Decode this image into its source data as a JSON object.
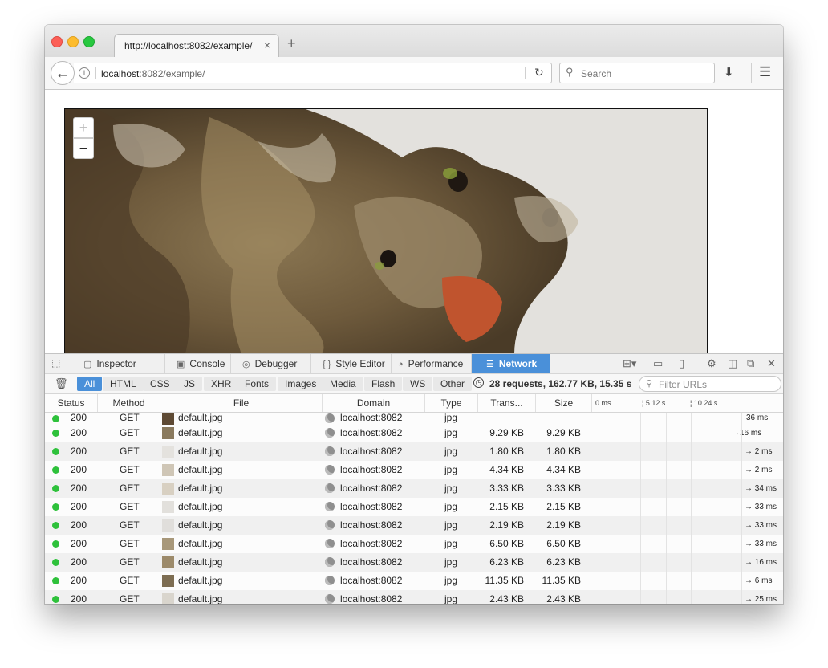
{
  "tab": {
    "title": "http://localhost:8082/example/",
    "close": "×",
    "new_tab": "+"
  },
  "nav": {
    "url_host": "localhost",
    "url_rest": ":8082/example/",
    "search_placeholder": "Search"
  },
  "viewer": {
    "zoom_in": "+",
    "zoom_out": "−"
  },
  "devtools": {
    "tabs": [
      {
        "label": "Inspector",
        "icon": "box-icon"
      },
      {
        "label": "Console",
        "icon": "console-icon"
      },
      {
        "label": "Debugger",
        "icon": "pause-icon"
      },
      {
        "label": "Style Editor",
        "icon": "braces-icon"
      },
      {
        "label": "Performance",
        "icon": "gauge-icon"
      },
      {
        "label": "Network",
        "icon": "network-icon",
        "active": true
      }
    ],
    "filters": [
      "All",
      "HTML",
      "CSS",
      "JS",
      "XHR",
      "Fonts",
      "Images",
      "Media",
      "Flash",
      "WS",
      "Other"
    ],
    "summary": "28 requests, 162.77 KB, 15.35 s",
    "filter_placeholder": "Filter URLs",
    "headers": [
      "Status",
      "Method",
      "File",
      "Domain",
      "Type",
      "Trans...",
      "Size"
    ],
    "timeline_ticks": [
      "0 ms",
      "5.12 s",
      "10.24 s"
    ],
    "partial_row": {
      "status": "200",
      "method": "GET",
      "file": "default.jpg",
      "domain": "localhost:8082",
      "type": "jpg",
      "timing": "36 ms"
    },
    "rows": [
      {
        "status": "200",
        "method": "GET",
        "file": "default.jpg",
        "domain": "localhost:8082",
        "type": "jpg",
        "transferred": "9.29 KB",
        "size": "9.29 KB",
        "timing": "→16 ms",
        "thumb": "#8a7a5e"
      },
      {
        "status": "200",
        "method": "GET",
        "file": "default.jpg",
        "domain": "localhost:8082",
        "type": "jpg",
        "transferred": "1.80 KB",
        "size": "1.80 KB",
        "timing": "→ 2 ms",
        "thumb": "#e4e2de"
      },
      {
        "status": "200",
        "method": "GET",
        "file": "default.jpg",
        "domain": "localhost:8082",
        "type": "jpg",
        "transferred": "4.34 KB",
        "size": "4.34 KB",
        "timing": "→ 2 ms",
        "thumb": "#cfc6b6"
      },
      {
        "status": "200",
        "method": "GET",
        "file": "default.jpg",
        "domain": "localhost:8082",
        "type": "jpg",
        "transferred": "3.33 KB",
        "size": "3.33 KB",
        "timing": "→ 34 ms",
        "thumb": "#d8d0c2"
      },
      {
        "status": "200",
        "method": "GET",
        "file": "default.jpg",
        "domain": "localhost:8082",
        "type": "jpg",
        "transferred": "2.15 KB",
        "size": "2.15 KB",
        "timing": "→ 33 ms",
        "thumb": "#e2e0dc"
      },
      {
        "status": "200",
        "method": "GET",
        "file": "default.jpg",
        "domain": "localhost:8082",
        "type": "jpg",
        "transferred": "2.19 KB",
        "size": "2.19 KB",
        "timing": "→ 33 ms",
        "thumb": "#e0dedb"
      },
      {
        "status": "200",
        "method": "GET",
        "file": "default.jpg",
        "domain": "localhost:8082",
        "type": "jpg",
        "transferred": "6.50 KB",
        "size": "6.50 KB",
        "timing": "→ 33 ms",
        "thumb": "#a8987a"
      },
      {
        "status": "200",
        "method": "GET",
        "file": "default.jpg",
        "domain": "localhost:8082",
        "type": "jpg",
        "transferred": "6.23 KB",
        "size": "6.23 KB",
        "timing": "→ 16 ms",
        "thumb": "#9c8a6a"
      },
      {
        "status": "200",
        "method": "GET",
        "file": "default.jpg",
        "domain": "localhost:8082",
        "type": "jpg",
        "transferred": "11.35 KB",
        "size": "11.35 KB",
        "timing": "→ 6 ms",
        "thumb": "#7d6d52"
      },
      {
        "status": "200",
        "method": "GET",
        "file": "default.jpg",
        "domain": "localhost:8082",
        "type": "jpg",
        "transferred": "2.43 KB",
        "size": "2.43 KB",
        "timing": "→ 25 ms",
        "thumb": "#d9d5cd"
      }
    ]
  },
  "colors": {
    "accent": "#4a90d9",
    "status_ok": "#2ec13b"
  }
}
